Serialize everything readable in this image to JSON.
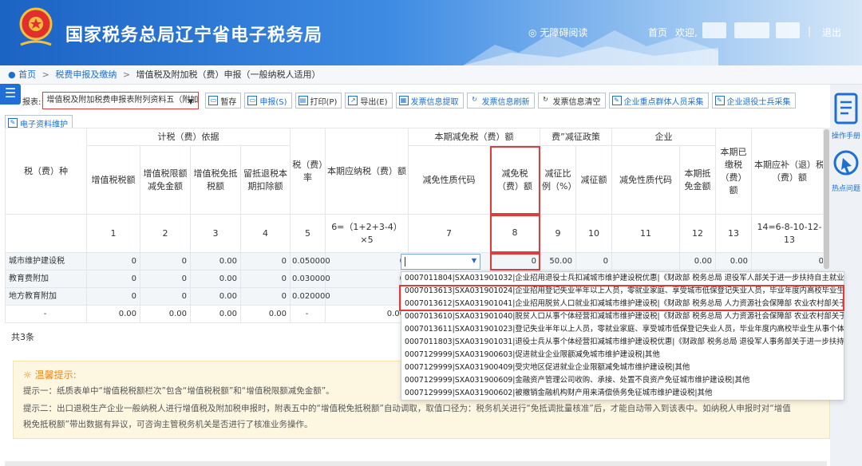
{
  "header": {
    "title": "国家税务总局辽宁省电子税务局",
    "accessibility_label": "无障碍阅读",
    "home_label": "首页",
    "welcome_label": "欢迎,",
    "logout_label": "退出",
    "separator": "|"
  },
  "breadcrumb": {
    "items": [
      "首页",
      "税费申报及缴纳",
      "增值税及附加税（费）申报（一般纳税人适用）"
    ],
    "separator": ">"
  },
  "toolbar": {
    "select_label": "报表:",
    "select_value": "增值税及附加税费申报表附列资料五（附加",
    "buttons": [
      "暂存",
      "申报(S)",
      "打印(P)",
      "导出(E)",
      "发票信息提取",
      "发票信息刷新",
      "发票信息清空",
      "企业重点群体人员采集",
      "企业退役士兵采集"
    ],
    "second_row_button": "电子资料维护"
  },
  "table": {
    "headers": {
      "tax_type": "税（费）种",
      "basis_group": "计税（费）依据",
      "vat_amount": "增值税税额",
      "vat_limit_reduction": "增值税限额减免金额",
      "vat_exempt_offset": "增值税免抵税额",
      "retained_refund": "留抵退税本期扣除额",
      "rate": "税（费）率",
      "payable": "本期应纳税（费）额",
      "reduction_group": "本期减免税（费）额",
      "reduction_code": "减免性质代码",
      "reduction_amount": "减免税（费）额",
      "policy_group_partial": "费”减征政策",
      "reduce_ratio": "减征比例（%）",
      "reduce_amount": "减征额",
      "enterprise_group": "企业",
      "enterprise_code": "减免性质代码",
      "offset_amount": "本期抵免金额",
      "paid": "本期已缴税（费）额",
      "refund": "本期应补（退）税（费）额"
    },
    "col_numbers": [
      "1",
      "2",
      "3",
      "4",
      "5",
      "6=（1+2+3-4）×5",
      "7",
      "8",
      "9",
      "10",
      "11",
      "12",
      "13",
      "14=6-8-10-12-13"
    ],
    "rows": [
      {
        "name": "城市维护建设税",
        "c1": "0",
        "c2": "0",
        "c3": "0.00",
        "c4": "0",
        "c5": "0.050000",
        "c6": "0",
        "c8": "0",
        "c9": "50.00",
        "c10": "0",
        "c12": "0.00",
        "c13": "0.00",
        "c14": "0"
      },
      {
        "name": "教育费附加",
        "c1": "0",
        "c2": "0",
        "c3": "0.00",
        "c4": "0",
        "c5": "0.030000",
        "c6": "0",
        "c8": "",
        "c9": "",
        "c10": "",
        "c12": "",
        "c13": "",
        "c14": ""
      },
      {
        "name": "地方教育附加",
        "c1": "0",
        "c2": "0",
        "c3": "0.00",
        "c4": "0",
        "c5": "0.020000",
        "c6": "0",
        "c8": "",
        "c9": "",
        "c10": "",
        "c12": "",
        "c13": "",
        "c14": ""
      },
      {
        "name": "-",
        "c1": "0.00",
        "c2": "0.00",
        "c3": "0.00",
        "c4": "0.00",
        "c5": "-",
        "c6": "0.00",
        "c8": "",
        "c9": "",
        "c10": "",
        "c12": "",
        "c13": "",
        "c14": ""
      }
    ],
    "total_label": "共3条"
  },
  "dropdown": {
    "items": [
      "0007011804|SXA031901032|企业招用退役士兵扣减城市维护建设税优惠|《财政部 税务总局 退役军人部关于进一步扶持自主就业退役士兵",
      "0007013613|SXA031901024|企业招用登记失业半年以上人员，零就业家庭、享受城市低保登记失业人员，毕业年度内高校毕业生就业扣减",
      "0007013612|SXA031901041|企业招用脱贫人口就业扣减城市维护建设税|《财政部 税务总局 人力资源社会保障部 农业农村部关于进一步",
      "0007013610|SXA031901040|脱贫人口从事个体经营扣减城市维护建设税|《财政部 税务总局 人力资源社会保障部 农业农村部关于进一步",
      "0007013611|SXA031901023|登记失业半年以上人员，零就业家庭、享受城市低保登记失业人员，毕业年度内高校毕业生从事个体经营扣减",
      "0007011803|SXA031901031|退役士兵从事个体经营扣减城市维护建设税优惠|《财政部 税务总局 退役军人事务部关于进一步扶持自主就业",
      "0007129999|SXA031900603|促进就业企业限额减免城市维护建设税|其他",
      "0007129999|SXA031900409|受灾地区促进就业企业限额减免城市维护建设税|其他",
      "0007129999|SXA031900609|金融资产管理公司收购、承接、处置不良资产免征城市维护建设税|其他",
      "0007129999|SXA031900602|被撤销金融机构财产用来清偿债务免征城市维护建设税|其他"
    ]
  },
  "tips": {
    "title": "温馨提示:",
    "line1": "提示一：纸质表单中“增值税税额栏次”包含“增值税税额”和“增值税限额减免金额”。",
    "line2": "提示二：出口退税生产企业一般纳税人进行增值税及附加税申报时，附表五中的“增值税免抵税额”自动调取，取值口径为：税务机关进行“免抵调批量核准”后，才能自动带入到该表中。如纳税人申报时对“增值",
    "line3": "税免抵税额”带出数据有异议，可咨询主管税务机关是否进行了核准业务操作。"
  },
  "right_tools": {
    "manual_label": "操作手册",
    "hot_label": "热点问题"
  },
  "colors": {
    "brand_blue": "#1d6fd1",
    "highlight_red": "#e03c3c",
    "tip_orange": "#e88b1f"
  }
}
